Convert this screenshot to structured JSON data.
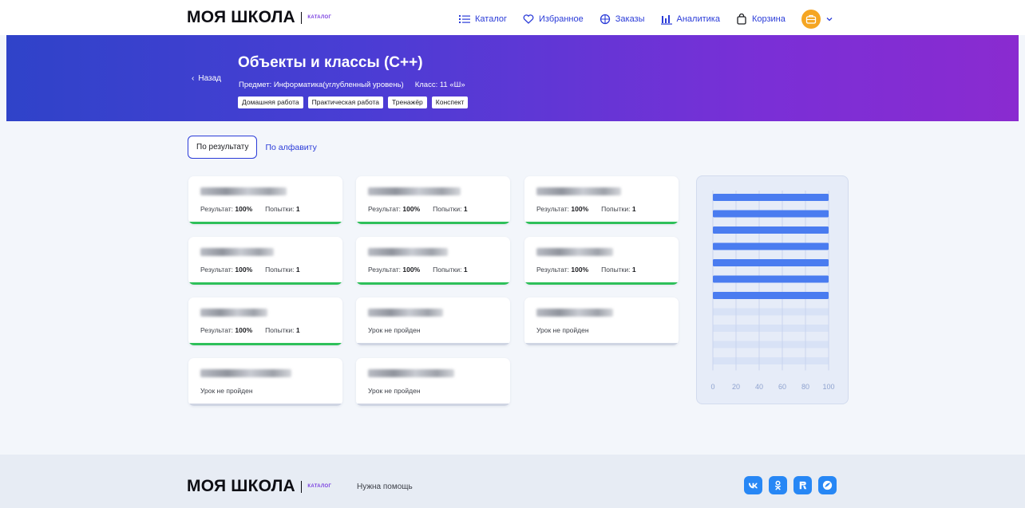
{
  "header": {
    "brand": "МОЯ ШКОЛА",
    "brand_sub": "каталог",
    "nav": [
      {
        "label": "Каталог",
        "icon": "list-icon"
      },
      {
        "label": "Избранное",
        "icon": "heart-icon"
      },
      {
        "label": "Заказы",
        "icon": "orders-icon"
      },
      {
        "label": "Аналитика",
        "icon": "bar-chart-icon"
      },
      {
        "label": "Корзина",
        "icon": "bag-icon"
      }
    ],
    "avatar_icon": "briefcase-icon"
  },
  "hero": {
    "back_label": "Назад",
    "title": "Объекты и классы (С++)",
    "subject": "Предмет: Информатика(углубленный уровень)",
    "class": "Класс: 11 «Ш»",
    "tags": [
      "Домашняя работа",
      "Практическая работа",
      "Тренажёр",
      "Конспект"
    ]
  },
  "sort": {
    "active": "По результату",
    "alt": "По алфавиту"
  },
  "students": [
    {
      "result_label": "Результат:",
      "result": "100%",
      "attempts_label": "Попытки:",
      "attempts": "1",
      "status": "",
      "done": true
    },
    {
      "result_label": "Результат:",
      "result": "100%",
      "attempts_label": "Попытки:",
      "attempts": "1",
      "status": "",
      "done": true
    },
    {
      "result_label": "Результат:",
      "result": "100%",
      "attempts_label": "Попытки:",
      "attempts": "1",
      "status": "",
      "done": true
    },
    {
      "result_label": "Результат:",
      "result": "100%",
      "attempts_label": "Попытки:",
      "attempts": "1",
      "status": "",
      "done": true
    },
    {
      "result_label": "Результат:",
      "result": "100%",
      "attempts_label": "Попытки:",
      "attempts": "1",
      "status": "",
      "done": true
    },
    {
      "result_label": "Результат:",
      "result": "100%",
      "attempts_label": "Попытки:",
      "attempts": "1",
      "status": "",
      "done": true
    },
    {
      "result_label": "Результат:",
      "result": "100%",
      "attempts_label": "Попытки:",
      "attempts": "1",
      "status": "",
      "done": true
    },
    {
      "result_label": "",
      "result": "",
      "attempts_label": "",
      "attempts": "",
      "status": "Урок не пройден",
      "done": false
    },
    {
      "result_label": "",
      "result": "",
      "attempts_label": "",
      "attempts": "",
      "status": "Урок не пройден",
      "done": false
    },
    {
      "result_label": "",
      "result": "",
      "attempts_label": "",
      "attempts": "",
      "status": "Урок не пройден",
      "done": false
    },
    {
      "result_label": "",
      "result": "",
      "attempts_label": "",
      "attempts": "",
      "status": "Урок не пройден",
      "done": false
    }
  ],
  "chart_data": {
    "type": "bar",
    "orientation": "horizontal",
    "values": [
      100,
      100,
      100,
      100,
      100,
      100,
      100,
      0,
      0,
      0,
      0
    ],
    "xticks": [
      "0",
      "20",
      "40",
      "60",
      "80",
      "100"
    ],
    "xlim": [
      0,
      100
    ],
    "grid": true,
    "bar_color": "#4a7cf0"
  },
  "footer": {
    "brand": "МОЯ ШКОЛА",
    "brand_sub": "каталог",
    "help": "Нужна помощь",
    "social": [
      "vk-icon",
      "ok-icon",
      "rutube-icon",
      "sferum-icon"
    ]
  }
}
